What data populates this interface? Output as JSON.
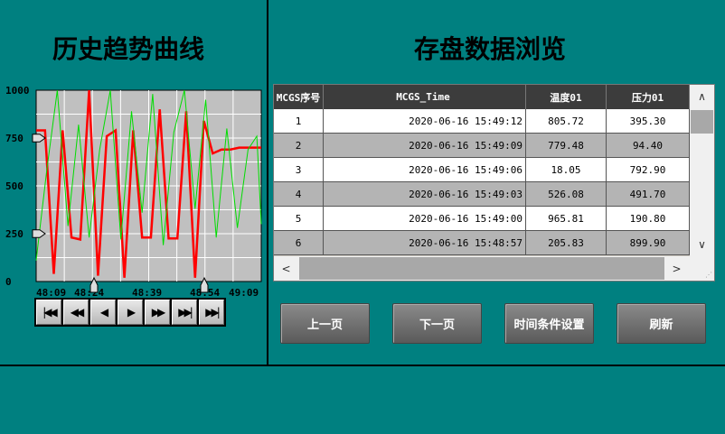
{
  "left_panel": {
    "title": "历史趋势曲线"
  },
  "right_panel": {
    "title": "存盘数据浏览"
  },
  "chart_data": {
    "type": "line",
    "ylim": [
      0,
      1000
    ],
    "yticks": [
      "0",
      "250",
      "500",
      "750",
      "1000"
    ],
    "xticks": [
      "48:09",
      "48:24",
      "48:39",
      "48:54",
      "49:09"
    ],
    "grid": true,
    "series": [
      {
        "color": "#ff0000",
        "x": [
          0,
          10,
          20,
          30,
          40,
          50,
          60,
          70,
          80,
          90,
          100,
          110,
          120,
          130,
          140,
          150,
          160,
          170,
          180,
          190,
          200,
          210,
          220,
          230,
          240,
          250,
          255
        ],
        "y": [
          790,
          790,
          40,
          790,
          230,
          220,
          1000,
          30,
          760,
          790,
          20,
          790,
          230,
          230,
          900,
          225,
          225,
          890,
          20,
          840,
          670,
          690,
          690,
          700,
          700,
          700,
          700
        ]
      },
      {
        "color": "#00dd00",
        "x": [
          0,
          12,
          24,
          36,
          48,
          60,
          72,
          84,
          96,
          108,
          120,
          132,
          144,
          156,
          168,
          180,
          192,
          204,
          216,
          228,
          240,
          250,
          255
        ],
        "y": [
          110,
          580,
          1000,
          290,
          820,
          230,
          690,
          1000,
          220,
          890,
          360,
          980,
          190,
          780,
          1000,
          380,
          950,
          230,
          800,
          280,
          690,
          760,
          300
        ]
      }
    ]
  },
  "colors": {
    "background": "#008080",
    "line_red": "#ff0000",
    "line_green": "#00dd00"
  },
  "player_controls": [
    "first-icon",
    "rewind-icon",
    "step-back-icon",
    "step-forward-icon",
    "fast-forward-icon",
    "skip-end-icon",
    "last-icon"
  ],
  "grid": {
    "headers": {
      "seq": "MCGS序号",
      "time": "MCGS_Time",
      "temp": "温度01",
      "pres": "压力01"
    },
    "rows": [
      {
        "seq": "1",
        "time": "2020-06-16 15:49:12",
        "temp": "805.72",
        "pres": "395.30"
      },
      {
        "seq": "2",
        "time": "2020-06-16 15:49:09",
        "temp": "779.48",
        "pres": "94.40"
      },
      {
        "seq": "3",
        "time": "2020-06-16 15:49:06",
        "temp": "18.05",
        "pres": "792.90"
      },
      {
        "seq": "4",
        "time": "2020-06-16 15:49:03",
        "temp": "526.08",
        "pres": "491.70"
      },
      {
        "seq": "5",
        "time": "2020-06-16 15:49:00",
        "temp": "965.81",
        "pres": "190.80"
      },
      {
        "seq": "6",
        "time": "2020-06-16 15:48:57",
        "temp": "205.83",
        "pres": "899.90"
      }
    ]
  },
  "buttons": {
    "prev": "上一页",
    "next": "下一页",
    "time_setting": "时间条件设置",
    "refresh": "刷新"
  }
}
